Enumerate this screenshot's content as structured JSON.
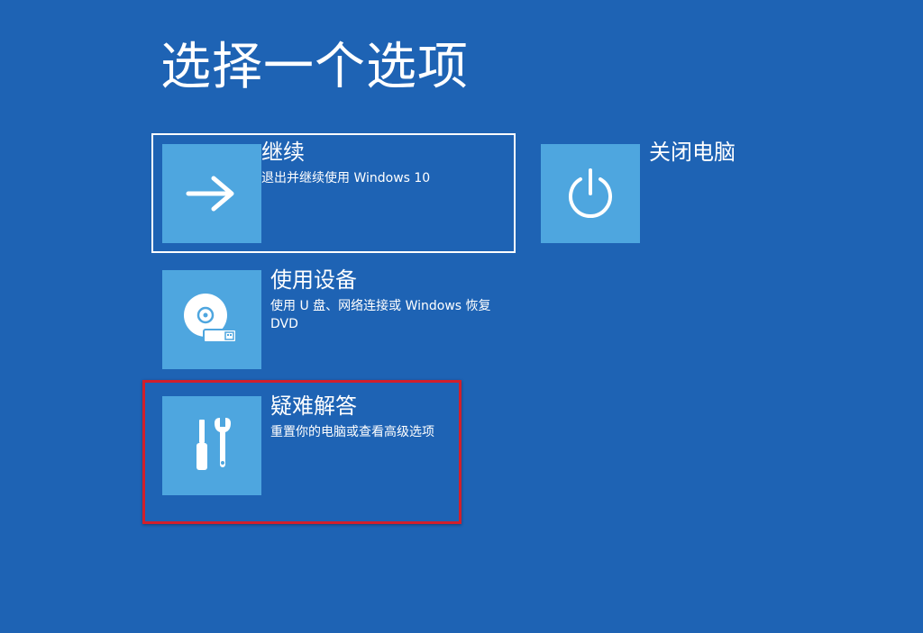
{
  "page": {
    "title": "选择一个选项"
  },
  "options": [
    {
      "id": "continue",
      "label": "继续",
      "description": "退出并继续使用 Windows 10",
      "icon": "arrow-right-icon"
    },
    {
      "id": "shutdown",
      "label": "关闭电脑",
      "description": "",
      "icon": "power-icon"
    },
    {
      "id": "use-device",
      "label": "使用设备",
      "description": "使用 U 盘、网络连接或 Windows 恢复 DVD",
      "icon": "disc-usb-icon"
    },
    {
      "id": "troubleshoot",
      "label": "疑难解答",
      "description": "重置你的电脑或查看高级选项",
      "icon": "tools-icon"
    }
  ],
  "colors": {
    "background": "#1e63b4",
    "tile": "#4ea6df",
    "focus_border": "#ffffff",
    "highlight": "#d11f2b"
  }
}
